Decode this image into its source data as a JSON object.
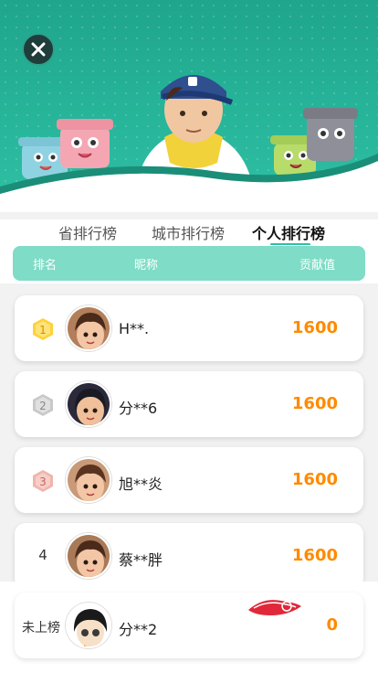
{
  "tabs": [
    {
      "label": "省排行榜",
      "active": false
    },
    {
      "label": "城市排行榜",
      "active": false
    },
    {
      "label": "个人排行榜",
      "active": true
    }
  ],
  "columns": {
    "rank": "排名",
    "nickname": "昵称",
    "contribution": "贡献值"
  },
  "rows": [
    {
      "rank": "1",
      "rank_style": "gold-badge",
      "name": "H**.",
      "score": "1600"
    },
    {
      "rank": "2",
      "rank_style": "silver-badge",
      "name": "分**6",
      "score": "1600"
    },
    {
      "rank": "3",
      "rank_style": "bronze-badge",
      "name": "旭**炎",
      "score": "1600"
    },
    {
      "rank": "4",
      "rank_style": "plain-number",
      "name": "蔡**胖",
      "score": "1600"
    }
  ],
  "self_entry": {
    "rank": "未上榜",
    "name": "分**2",
    "score": "0"
  },
  "colors": {
    "accent_green": "#2fc0a4",
    "header_bar": "#7fdcc6",
    "score_orange": "#ff8a00",
    "gold": "#ffd23a",
    "silver": "#c9c9c9",
    "bronze": "#f0b5ac"
  }
}
